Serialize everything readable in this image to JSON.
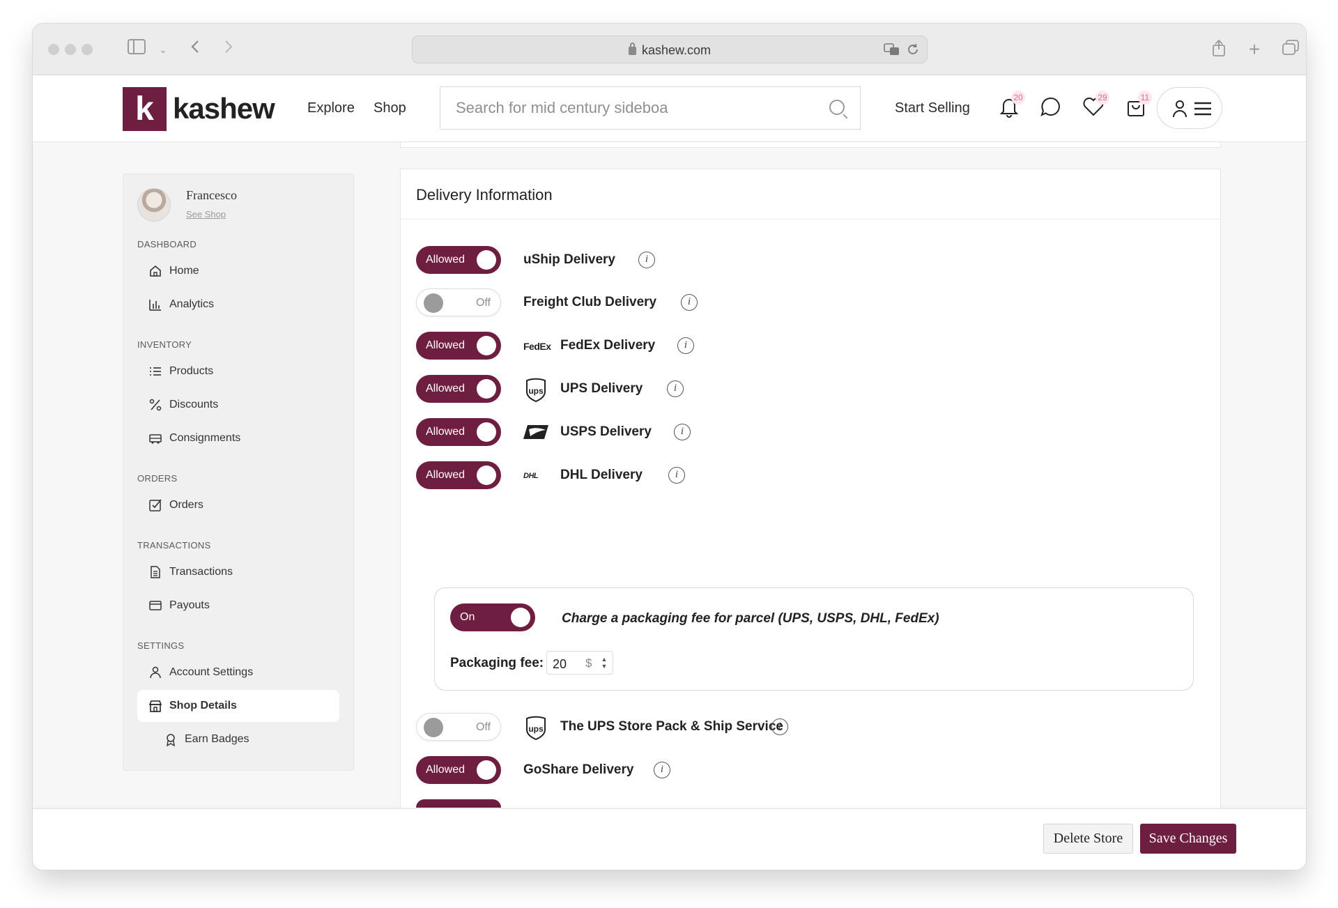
{
  "browser": {
    "url": "kashew.com"
  },
  "header": {
    "logo_mark": "k",
    "logo_text": "kashew",
    "nav": [
      "Explore",
      "Shop"
    ],
    "search_placeholder": "Search for mid century sideboa",
    "start_selling": "Start Selling",
    "notifications_count": "20",
    "favorites_count": "29",
    "cart_count": "11"
  },
  "sidebar": {
    "user_name": "Francesco",
    "see_shop": "See Shop",
    "sections": {
      "dashboard": "DASHBOARD",
      "inventory": "INVENTORY",
      "orders": "ORDERS",
      "transactions": "TRANSACTIONS",
      "settings": "SETTINGS"
    },
    "items": {
      "home": "Home",
      "analytics": "Analytics",
      "products": "Products",
      "discounts": "Discounts",
      "consignments": "Consignments",
      "orders": "Orders",
      "transactions": "Transactions",
      "payouts": "Payouts",
      "account_settings": "Account Settings",
      "shop_details": "Shop Details",
      "earn_badges": "Earn Badges"
    }
  },
  "delivery": {
    "title": "Delivery Information",
    "rows": [
      {
        "label": "uShip Delivery",
        "state": "Allowed"
      },
      {
        "label": "Freight Club Delivery",
        "state": "Off"
      },
      {
        "label": "FedEx Delivery",
        "state": "Allowed"
      },
      {
        "label": "UPS Delivery",
        "state": "Allowed"
      },
      {
        "label": "USPS Delivery",
        "state": "Allowed"
      },
      {
        "label": "DHL Delivery",
        "state": "Allowed"
      }
    ],
    "packaging": {
      "state": "On",
      "text": "Charge a packaging fee for parcel (UPS, USPS, DHL, FedEx)",
      "fee_label": "Packaging fee:",
      "fee_value": "20",
      "currency": "$"
    },
    "rows_after": [
      {
        "label": "The UPS Store Pack & Ship Service",
        "state": "Off"
      },
      {
        "label": "GoShare Delivery",
        "state": "Allowed"
      }
    ],
    "fedex_logo": "FedEx",
    "ups_logo": "ups",
    "dhl_logo": "DHL"
  },
  "footer": {
    "delete_label": "Delete Store",
    "save_label": "Save Changes"
  },
  "colors": {
    "brand": "#6e1f41",
    "badge": "#e06a92"
  }
}
